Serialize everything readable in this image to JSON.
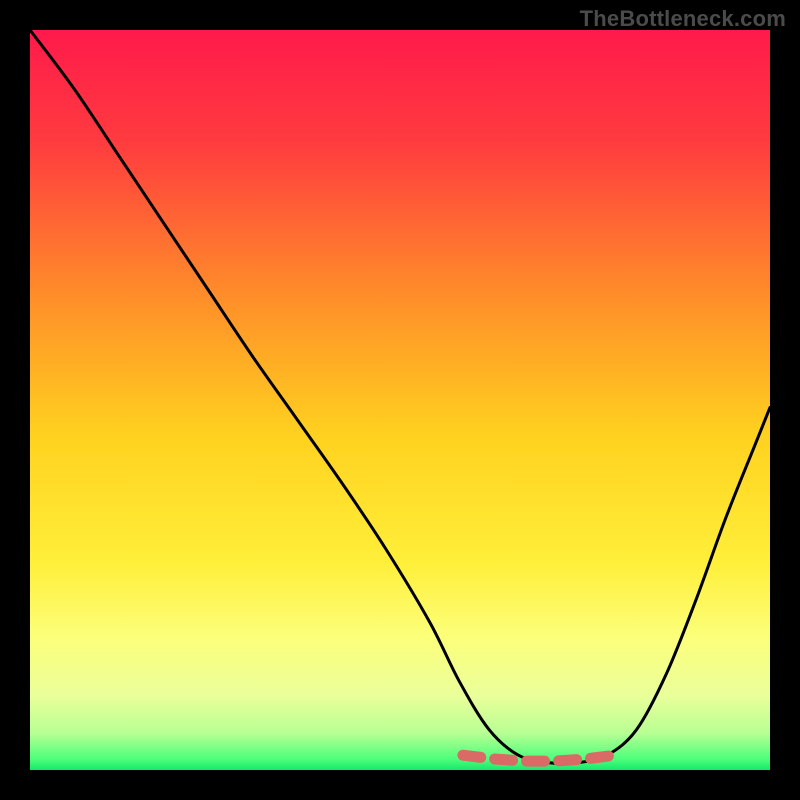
{
  "watermark": "TheBottleneck.com",
  "chart_data": {
    "type": "line",
    "title": "",
    "xlabel": "",
    "ylabel": "",
    "xlim": [
      0,
      1
    ],
    "ylim": [
      0,
      1
    ],
    "gradient_stops": [
      {
        "offset": 0.0,
        "color": "#ff1a4b"
      },
      {
        "offset": 0.15,
        "color": "#ff3b3f"
      },
      {
        "offset": 0.35,
        "color": "#ff8a2a"
      },
      {
        "offset": 0.55,
        "color": "#ffd21f"
      },
      {
        "offset": 0.72,
        "color": "#ffef3a"
      },
      {
        "offset": 0.82,
        "color": "#fcff7a"
      },
      {
        "offset": 0.9,
        "color": "#eaff9a"
      },
      {
        "offset": 0.95,
        "color": "#b8ff93"
      },
      {
        "offset": 0.985,
        "color": "#4eff7c"
      },
      {
        "offset": 1.0,
        "color": "#17e86a"
      }
    ],
    "series": [
      {
        "name": "bottleneck-curve",
        "color": "#000000",
        "width": 3,
        "x": [
          0.0,
          0.06,
          0.12,
          0.18,
          0.24,
          0.3,
          0.36,
          0.42,
          0.48,
          0.54,
          0.58,
          0.62,
          0.66,
          0.7,
          0.74,
          0.78,
          0.82,
          0.86,
          0.9,
          0.94,
          0.98,
          1.0
        ],
        "y": [
          1.0,
          0.92,
          0.83,
          0.74,
          0.65,
          0.56,
          0.475,
          0.39,
          0.3,
          0.2,
          0.12,
          0.055,
          0.02,
          0.01,
          0.01,
          0.02,
          0.055,
          0.13,
          0.23,
          0.34,
          0.44,
          0.49
        ]
      },
      {
        "name": "bottom-marker",
        "color": "#d96a66",
        "width": 11,
        "marker_style": "rounded-dash",
        "x": [
          0.585,
          0.626,
          0.668,
          0.71,
          0.752,
          0.79
        ],
        "y": [
          0.02,
          0.015,
          0.012,
          0.012,
          0.015,
          0.02
        ]
      }
    ]
  }
}
